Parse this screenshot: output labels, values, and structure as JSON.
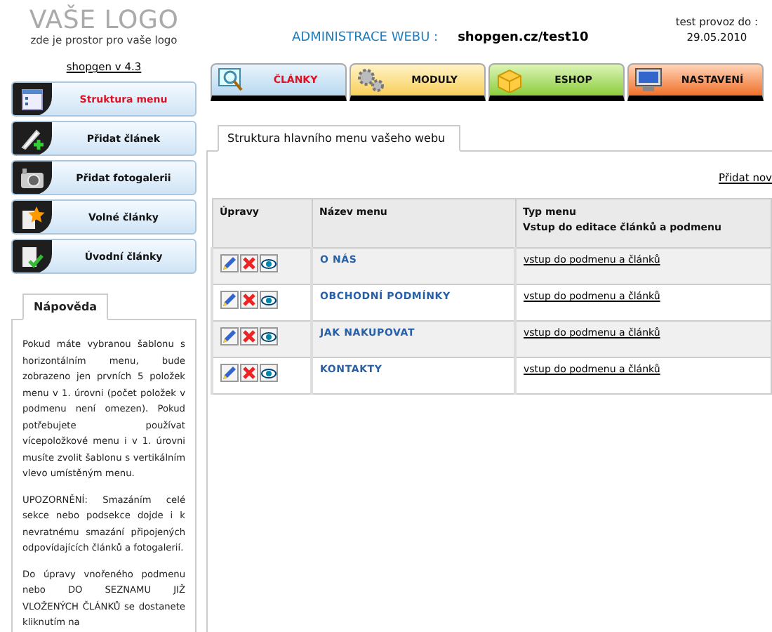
{
  "logo": {
    "title": "VAŠE LOGO",
    "subtitle": "zde je prostor pro vaše logo"
  },
  "version_link": "shopgen v 4.3",
  "header": {
    "title": "ADMINISTRACE WEBU :",
    "site": "shopgen.cz/test10",
    "trial_label": "test provoz do :",
    "trial_date": "29.05.2010"
  },
  "tabs": [
    {
      "label": "ČLÁNKY",
      "kind": "search",
      "selected": true
    },
    {
      "label": "MODULY",
      "kind": "gears",
      "selected": false
    },
    {
      "label": "ESHOP",
      "kind": "box",
      "selected": false
    },
    {
      "label": "NASTAVENÍ",
      "kind": "monitor",
      "selected": false
    }
  ],
  "sidebar": {
    "items": [
      {
        "label": "Struktura menu",
        "kind": "window",
        "selected": true
      },
      {
        "label": "Přidat článek",
        "kind": "pencil",
        "selected": false
      },
      {
        "label": "Přidat fotogalerii",
        "kind": "camera",
        "selected": false
      },
      {
        "label": "Volné články",
        "kind": "star",
        "selected": false
      },
      {
        "label": "Úvodní články",
        "kind": "check",
        "selected": false
      }
    ]
  },
  "help": {
    "title": "Nápověda",
    "paragraphs": [
      "Pokud máte vybranou šablonu s horizontálním menu, bude zobrazeno jen prvních 5 položek menu v 1. úrovni (počet položek v podmenu není omezen). Pokud potřebujete používat vícepoložkové menu i v 1. úrovni musíte zvolit šablonu s vertikálním vlevo umístěným menu.",
      "UPOZORNĚNÍ: Smazáním celé sekce nebo podsekce dojde i k nevratnému smazání připojených odpovídajících článků a fotogalerií.",
      "Do úpravy vnořeného podmenu nebo DO SEZNAMU JIŽ VLOŽENÝCH ČLÁNKŮ se dostanete kliknutím na"
    ]
  },
  "panel": {
    "title": "Struktura hlavního menu vašeho webu",
    "add_link": "Přidat nov",
    "table": {
      "columns": [
        "Úpravy",
        "Název menu",
        "Typ menu"
      ],
      "column_note": "Vstup do editace článků a podmenu",
      "rows": [
        {
          "name": "O NÁS",
          "link": "vstup do podmenu a článků"
        },
        {
          "name": "OBCHODNÍ PODMÍNKY",
          "link": "vstup do podmenu a článků"
        },
        {
          "name": "JAK NAKUPOVAT",
          "link": "vstup do podmenu a článků"
        },
        {
          "name": "KONTAKTY",
          "link": "vstup do podmenu a článků"
        }
      ]
    }
  }
}
